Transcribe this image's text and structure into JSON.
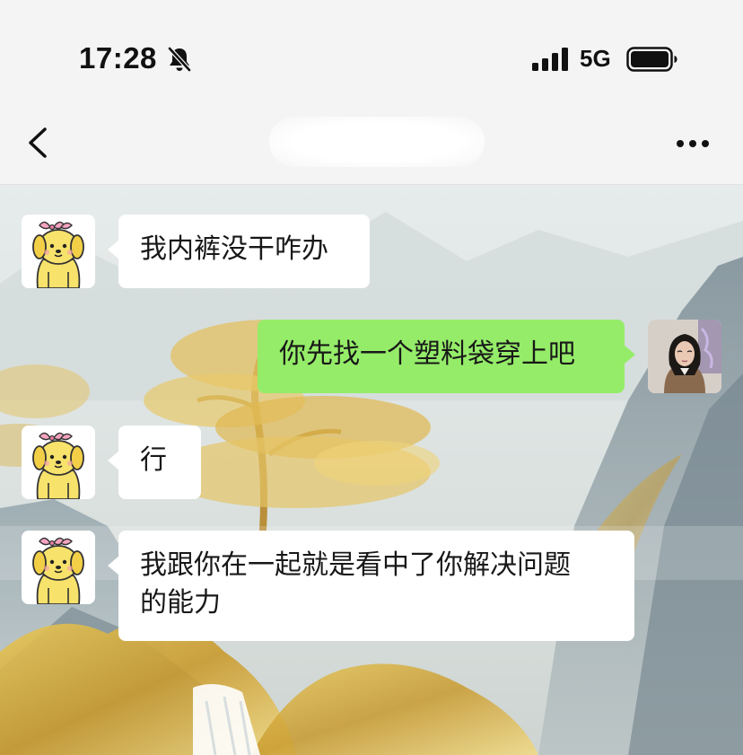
{
  "status_bar": {
    "time": "17:28",
    "network": "5G",
    "icons": [
      "bell-off-icon",
      "signal-bars-icon",
      "battery-icon"
    ]
  },
  "nav": {
    "back_icon": "chevron-left-icon",
    "more_icon": "ellipsis-icon"
  },
  "messages": [
    {
      "side": "left",
      "avatar": "yellow-dog-avatar",
      "text": "我内裤没干咋办"
    },
    {
      "side": "right",
      "avatar": "user-photo-avatar",
      "text": "你先找一个塑料袋穿上吧"
    },
    {
      "side": "left",
      "avatar": "yellow-dog-avatar",
      "text": "行"
    },
    {
      "side": "left",
      "avatar": "yellow-dog-avatar",
      "text": "我跟你在一起就是看中了你解决问题\n的能力"
    }
  ],
  "colors": {
    "self_bubble": "#95ec69",
    "other_bubble": "#ffffff",
    "bar_background": "#f4f4f4"
  }
}
